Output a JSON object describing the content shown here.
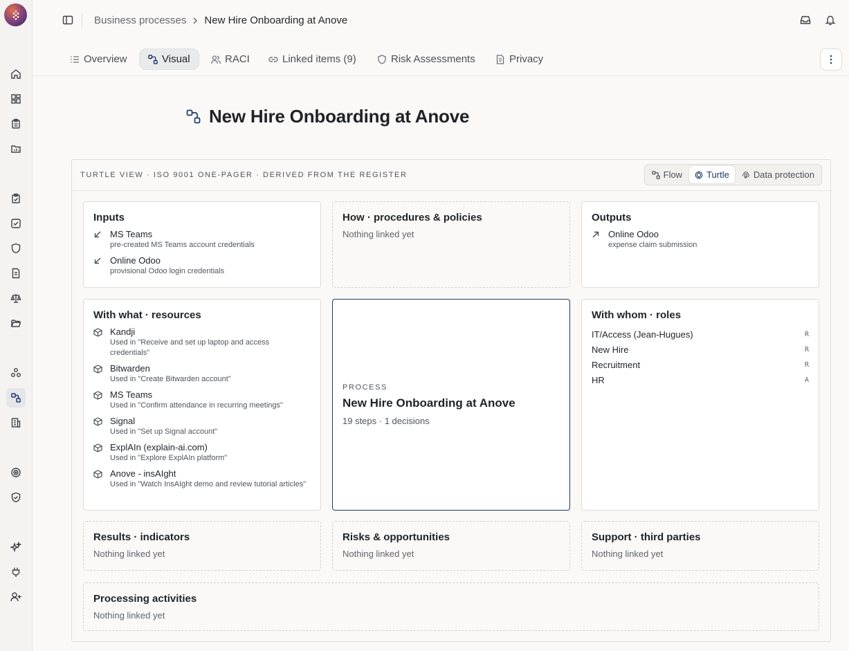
{
  "breadcrumb": {
    "parent": "Business processes",
    "current": "New Hire Onboarding at Anove"
  },
  "tabs": [
    {
      "label": "Overview",
      "icon": "list-icon"
    },
    {
      "label": "Visual",
      "icon": "flow-icon",
      "active": true
    },
    {
      "label": "RACI",
      "icon": "users-icon"
    },
    {
      "label": "Linked items (9)",
      "icon": "link-icon"
    },
    {
      "label": "Risk Assessments",
      "icon": "shield-icon"
    },
    {
      "label": "Privacy",
      "icon": "document-icon"
    }
  ],
  "page": {
    "title": "New Hire Onboarding at Anove"
  },
  "panel": {
    "caption": "TURTLE VIEW · ISO 9001 ONE-PAGER · DERIVED FROM THE REGISTER",
    "view_switch": [
      {
        "label": "Flow",
        "icon": "flow-icon"
      },
      {
        "label": "Turtle",
        "icon": "turtle-icon",
        "active": true
      },
      {
        "label": "Data protection",
        "icon": "fingerprint-icon"
      }
    ]
  },
  "inputs": {
    "title": "Inputs",
    "items": [
      {
        "name": "MS Teams",
        "desc": "pre-created MS Teams account credentials"
      },
      {
        "name": "Online Odoo",
        "desc": "provisional Odoo login credentials"
      }
    ]
  },
  "how": {
    "title": "How · procedures & policies",
    "empty": "Nothing linked yet"
  },
  "outputs": {
    "title": "Outputs",
    "items": [
      {
        "name": "Online Odoo",
        "desc": "expense claim submission"
      }
    ]
  },
  "resources": {
    "title": "With what · resources",
    "items": [
      {
        "name": "Kandji",
        "desc": "Used in \"Receive and set up laptop and access credentials\""
      },
      {
        "name": "Bitwarden",
        "desc": "Used in \"Create Bitwarden account\""
      },
      {
        "name": "MS Teams",
        "desc": "Used in \"Confirm attendance in recurring meetings\""
      },
      {
        "name": "Signal",
        "desc": "Used in \"Set up Signal account\""
      },
      {
        "name": "ExplAIn (explain-ai.com)",
        "desc": "Used in \"Explore ExplAIn platform\""
      },
      {
        "name": "Anove - insAIght",
        "desc": "Used in \"Watch InsAIght demo and review tutorial articles\""
      }
    ]
  },
  "process": {
    "label": "PROCESS",
    "name": "New Hire Onboarding at Anove",
    "meta": "19 steps · 1 decisions"
  },
  "roles": {
    "title": "With whom · roles",
    "items": [
      {
        "name": "IT/Access (Jean-Hugues)",
        "code": "R"
      },
      {
        "name": "New Hire",
        "code": "R"
      },
      {
        "name": "Recruitment",
        "code": "R"
      },
      {
        "name": "HR",
        "code": "A"
      }
    ]
  },
  "results": {
    "title": "Results · indicators",
    "empty": "Nothing linked yet"
  },
  "risks": {
    "title": "Risks & opportunities",
    "empty": "Nothing linked yet"
  },
  "support": {
    "title": "Support · third parties",
    "empty": "Nothing linked yet"
  },
  "processing": {
    "title": "Processing activities",
    "empty": "Nothing linked yet"
  },
  "colors": {
    "accent": "#1e3a6a",
    "background": "#faf9f7",
    "rail": "#f4f3f1"
  }
}
